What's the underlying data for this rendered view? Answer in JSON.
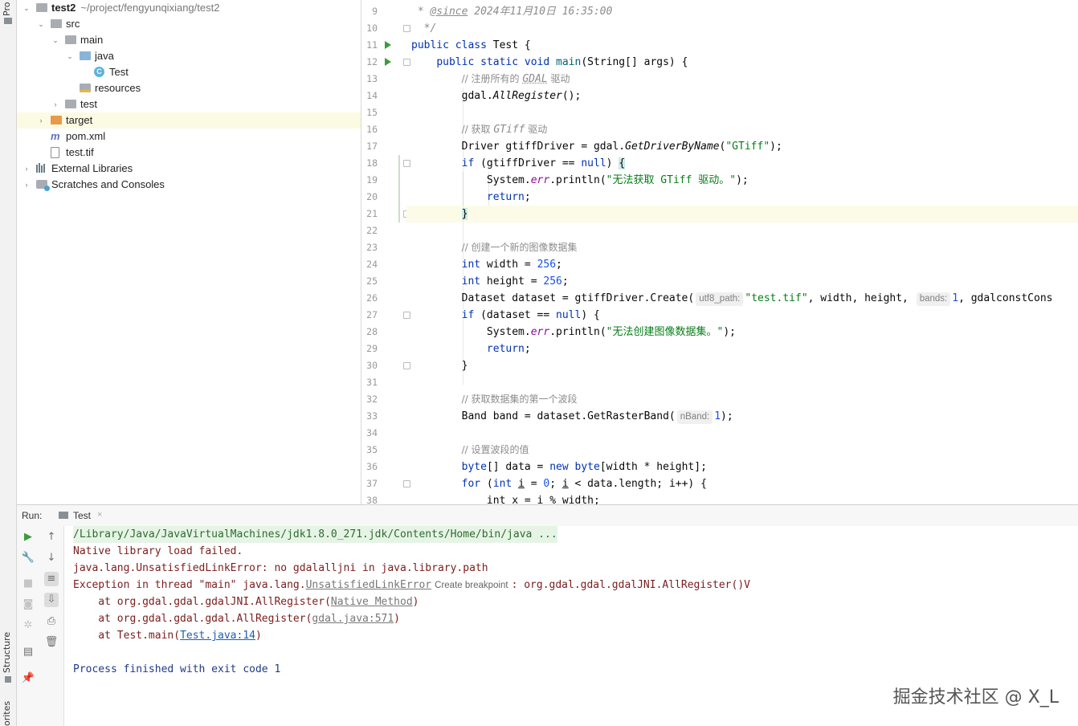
{
  "side_tabs": {
    "project": "Pro",
    "structure": "Structure",
    "favorites": "orites"
  },
  "project_tree": [
    {
      "label": "test2",
      "path": "~/project/fengyunqixiang/test2",
      "icon": "module-icon",
      "arrow": "⌄",
      "depth": 0
    },
    {
      "label": "src",
      "icon": "folder-icon",
      "arrow": "⌄",
      "depth": 1
    },
    {
      "label": "main",
      "icon": "folder-icon",
      "arrow": "⌄",
      "depth": 2
    },
    {
      "label": "java",
      "icon": "source-folder-icon",
      "arrow": "⌄",
      "depth": 3
    },
    {
      "label": "Test",
      "icon": "java-class-icon",
      "arrow": "",
      "depth": 4
    },
    {
      "label": "resources",
      "icon": "resources-folder-icon",
      "arrow": "",
      "depth": 3
    },
    {
      "label": "test",
      "icon": "folder-icon",
      "arrow": "›",
      "depth": 2
    },
    {
      "label": "target",
      "icon": "excluded-folder-icon",
      "arrow": "›",
      "depth": 1,
      "selected": true
    },
    {
      "label": "pom.xml",
      "icon": "maven-icon",
      "arrow": "",
      "depth": 1
    },
    {
      "label": "test.tif",
      "icon": "file-icon",
      "arrow": "",
      "depth": 1
    },
    {
      "label": "External Libraries",
      "icon": "library-icon",
      "arrow": "›",
      "depth": 0
    },
    {
      "label": "Scratches and Consoles",
      "icon": "scratches-icon",
      "arrow": "›",
      "depth": 0
    }
  ],
  "editor": {
    "line_numbers": [
      "9",
      "10",
      "11",
      "12",
      "13",
      "14",
      "15",
      "16",
      "17",
      "18",
      "19",
      "20",
      "21",
      "22",
      "23",
      "24",
      "25",
      "26",
      "27",
      "28",
      "29",
      "30",
      "31",
      "32",
      "33",
      "34",
      "35",
      "36",
      "37",
      "38"
    ],
    "since_tag": "@since",
    "since_date": " 2024年11月10日 16:35:00",
    "comment_end": "*/",
    "class_name": "Test",
    "args": "String[] args",
    "comment_register": "// 注册所有的 ",
    "comment_register_gdal": "GDAL",
    "comment_register_end": " 驱动",
    "all_register": "AllRegister",
    "comment_get_driver": "// 获取 ",
    "comment_get_driver_gtiff": "GTiff",
    "comment_get_driver_end": " 驱动",
    "driver_var": "Driver gtiffDriver = gdal.",
    "get_driver_method": "GetDriverByName",
    "gtiff_str": "\"GTiff\"",
    "if_null_1": "(gtiffDriver == ",
    "null_kw": "null",
    "err_field": "err",
    "msg_no_driver": "\"无法获取 GTiff 驱动。\"",
    "return_kw": "return",
    "comment_create": "// 创建一个新的图像数据集",
    "int_kw": "int",
    "width_decl": " width = ",
    "height_decl": " height = ",
    "size_value": "256",
    "create_prefix": "Dataset dataset = gtiffDriver.Create(",
    "hint_utf8": "utf8_path:",
    "tif_str": "\"test.tif\"",
    "create_mid": ", width, height, ",
    "hint_bands": "bands:",
    "bands_value": "1",
    "create_tail": ", gdalconstCons",
    "if_dataset": "(dataset == ",
    "msg_no_dataset": "\"无法创建图像数据集。\"",
    "comment_band": "// 获取数据集的第一个波段",
    "band_prefix": "Band band = dataset.GetRasterBand(",
    "hint_nband": "nBand:",
    "band_value": "1",
    "comment_set": "// 设置波段的值",
    "byte_kw": "byte",
    "new_kw": "new",
    "data_decl": "[] data = ",
    "data_size": "[width * height];",
    "for_kw": "for",
    "zero": "0",
    "loop_var": "i",
    "loop_cond": " < data.length; ",
    "loop_incr": "i++) {",
    "last_line": "int x = i % width;"
  },
  "run_panel": {
    "run_label": "Run:",
    "tab_label": "Test",
    "console": [
      {
        "text": "/Library/Java/JavaVirtualMachines/jdk1.8.0_271.jdk/Contents/Home/bin/java ...",
        "kind": "cmdline"
      },
      {
        "text": "Native library load failed.",
        "kind": "err"
      },
      {
        "text": "java.lang.UnsatisfiedLinkError: no gdalalljni in java.library.path",
        "kind": "err"
      }
    ],
    "exception_prefix": "Exception in thread \"main\" java.lang.",
    "exception_link": "UnsatisfiedLinkError",
    "breakpoint_hint": "Create breakpoint",
    "exception_suffix": ": org.gdal.gdal.gdalJNI.AllRegister()V",
    "trace1_prefix": "    at org.gdal.gdal.gdalJNI.AllRegister(",
    "trace1_link": "Native Method",
    "trace2_prefix": "    at org.gdal.gdal.gdal.AllRegister(",
    "trace2_link": "gdal.java:571",
    "trace3_prefix": "    at Test.main(",
    "trace3_link": "Test.java:14",
    "close_paren": ")",
    "exit_text": "Process finished with exit code 1"
  },
  "watermark": "掘金技术社区 @ X_L"
}
